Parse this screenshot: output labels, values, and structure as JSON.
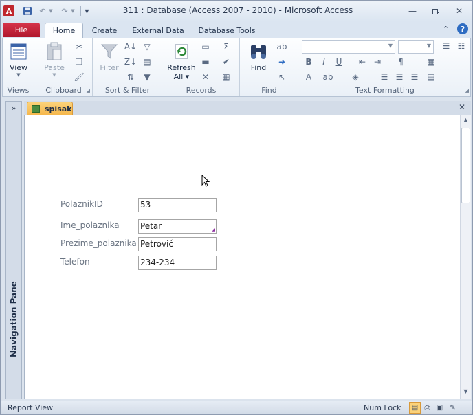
{
  "window": {
    "title": "311 : Database (Access 2007 - 2010)  -  Microsoft Access",
    "app_icon_glyph": "A"
  },
  "tabs": {
    "file": "File",
    "home": "Home",
    "create": "Create",
    "external_data": "External Data",
    "database_tools": "Database Tools"
  },
  "ribbon": {
    "views": {
      "label": "Views",
      "view_btn": "View"
    },
    "clipboard": {
      "label": "Clipboard",
      "paste_btn": "Paste"
    },
    "sort_filter": {
      "label": "Sort & Filter",
      "filter_btn": "Filter"
    },
    "records": {
      "label": "Records",
      "refresh_btn": "Refresh",
      "refresh_sub": "All"
    },
    "find": {
      "label": "Find",
      "find_btn": "Find"
    },
    "text_formatting": {
      "label": "Text Formatting"
    }
  },
  "navigation_pane": {
    "label": "Navigation Pane",
    "expand_glyph": "»"
  },
  "document": {
    "tab_name": "spisak",
    "fields": [
      {
        "label": "PolaznikID",
        "value": "53"
      },
      {
        "label": "Ime_polaznika",
        "value": "Petar"
      },
      {
        "label": "Prezime_polaznika",
        "value": "Petrović"
      },
      {
        "label": "Telefon",
        "value": "234-234"
      }
    ]
  },
  "statusbar": {
    "text": "Report View",
    "numlock": "Num Lock"
  },
  "colors": {
    "file_tab": "#c41e3a",
    "doc_tab": "#f5b64a",
    "accent": "#2e6cc2"
  }
}
